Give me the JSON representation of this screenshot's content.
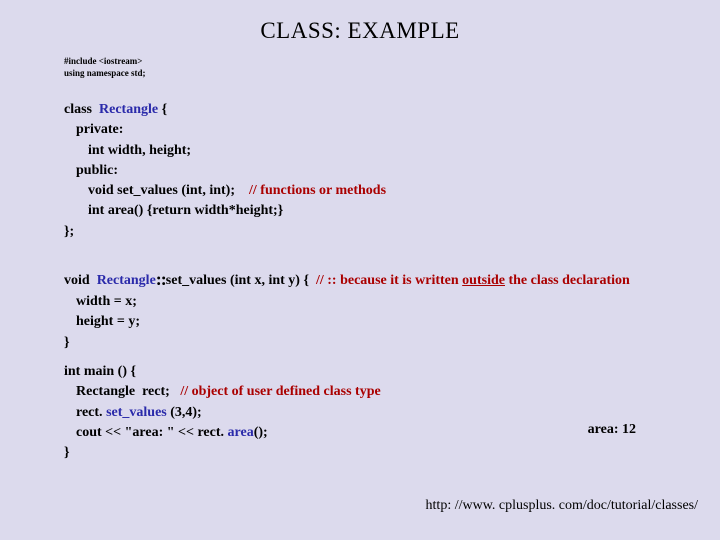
{
  "title": "CLASS: EXAMPLE",
  "includes": {
    "l1": "#include <iostream>",
    "l2": "using namespace std;"
  },
  "classDecl": {
    "l1a": "class  ",
    "l1b": "Rectangle",
    "l1c": " {",
    "l2": "private:",
    "l3": "int width, height;",
    "l4": "public:",
    "l5a": "void set_values (int, int);    ",
    "l5b": "// functions or methods",
    "l6": "int area() {return width*height;}",
    "l7": "};"
  },
  "methodDef": {
    "l1a": "void  ",
    "l1b": "Rectangle",
    "l1c": "::",
    "l1d": "set_values (int x, int y) {  ",
    "l1e": "// :: because it is written ",
    "l1f": "outside",
    "l1g": " the class declaration",
    "l2": "width = x;",
    "l3": "height = y;",
    "l4": "}"
  },
  "mainFn": {
    "l1": "int  main () {",
    "l2a": "Rectangle  rect;   ",
    "l2b": "// object of user defined class type",
    "l3a": "rect.",
    "l3b": " set_values ",
    "l3c": "(3,4);",
    "l4a": "cout << \"area: \" << rect.",
    "l4b": " area",
    "l4c": "();",
    "l5": "}"
  },
  "output": {
    "label": "area: 12"
  },
  "footer": {
    "url": "http: //www. cplusplus. com/doc/tutorial/classes/"
  }
}
